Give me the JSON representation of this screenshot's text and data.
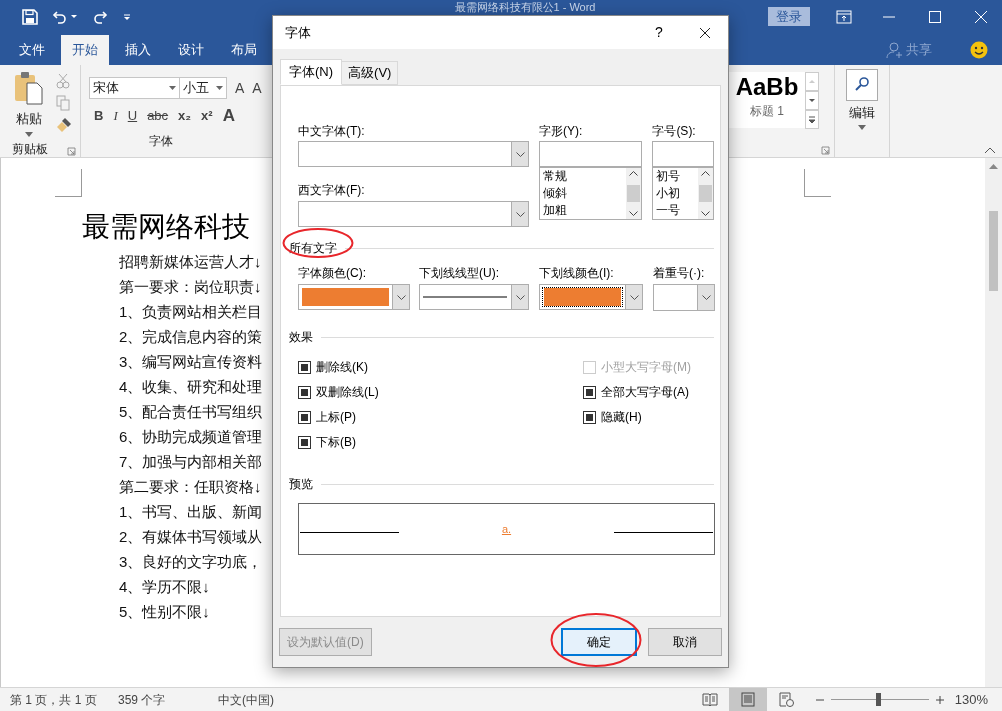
{
  "window": {
    "title": "最需网络科技有限公1 - Word",
    "signin": "登录",
    "share": "共享"
  },
  "tabs": [
    {
      "label": "文件",
      "selected": false
    },
    {
      "label": "开始",
      "selected": true
    },
    {
      "label": "插入",
      "selected": false
    },
    {
      "label": "设计",
      "selected": false
    },
    {
      "label": "布局",
      "selected": false
    }
  ],
  "ribbon": {
    "paste": "粘贴",
    "clipboard_label": "剪贴板",
    "font_name": "宋体",
    "font_size": "小五",
    "size_buttons": [
      "A",
      "A"
    ],
    "format_buttons": [
      "B",
      "I",
      "U",
      "abc",
      "x₂",
      "x²",
      "A"
    ],
    "font_label": "字体",
    "style_sample": "AaBb",
    "style_name": "标题 1",
    "editing_label": "编辑"
  },
  "document": {
    "title": "最需网络科技",
    "lines": [
      "招聘新媒体运营人才↓",
      "第一要求：岗位职责↓",
      "1、负责网站相关栏目",
      "2、完成信息内容的策",
      "3、编写网站宣传资料",
      "4、收集、研究和处理",
      "5、配合责任书写组织",
      "6、协助完成频道管理",
      "7、加强与内部相关部",
      "第二要求：任职资格↓",
      "1、书写、出版、新闻",
      "2、有媒体书写领域从",
      "3、良好的文字功底，",
      "4、学历不限↓",
      "5、性别不限↓"
    ]
  },
  "dialog": {
    "title": "字体",
    "help": "?",
    "tabs": [
      {
        "label": "字体(N)",
        "selected": true
      },
      {
        "label": "高级(V)",
        "selected": false
      }
    ],
    "chinese_font": {
      "label": "中文字体(T):"
    },
    "western_font": {
      "label": "西文字体(F):"
    },
    "font_style": {
      "label": "字形(Y):",
      "options": [
        {
          "label": "常规",
          "selected": false
        },
        {
          "label": "倾斜",
          "selected": false
        },
        {
          "label": "加粗",
          "selected": false
        }
      ]
    },
    "font_size": {
      "label": "字号(S):",
      "options": [
        {
          "label": "初号",
          "selected": false
        },
        {
          "label": "小初",
          "selected": false
        },
        {
          "label": "一号",
          "selected": false
        }
      ]
    },
    "all_text": {
      "title": "所有文字",
      "font_color": {
        "label": "字体颜色(C):",
        "color": "#ed7d31"
      },
      "underline_style": {
        "label": "下划线线型(U):",
        "kind": "single"
      },
      "underline_color": {
        "label": "下划线颜色(I):",
        "color": "#ed7d31",
        "focused": true
      },
      "emphasis": {
        "label": "着重号(·):"
      }
    },
    "effects": {
      "title": "效果",
      "left": [
        {
          "label": "删除线(K)",
          "checked": true,
          "disabled": false
        },
        {
          "label": "双删除线(L)",
          "checked": true,
          "disabled": false
        },
        {
          "label": "上标(P)",
          "checked": true,
          "disabled": false
        },
        {
          "label": "下标(B)",
          "checked": true,
          "disabled": false
        }
      ],
      "right": [
        {
          "label": "小型大写字母(M)",
          "checked": false,
          "disabled": true
        },
        {
          "label": "全部大写字母(A)",
          "checked": true,
          "disabled": false
        },
        {
          "label": "隐藏(H)",
          "checked": true,
          "disabled": false
        }
      ]
    },
    "preview": {
      "title": "预览",
      "text": "a."
    },
    "buttons": [
      {
        "label": "设为默认值(D)",
        "kind": "normal",
        "disabled": true
      },
      {
        "label": "确定",
        "kind": "default",
        "disabled": false
      },
      {
        "label": "取消",
        "kind": "normal",
        "disabled": false
      }
    ]
  },
  "status_bar": {
    "page": "第 1 页，共 1 页",
    "words": "359 个字",
    "language": "中文(中国)",
    "views": [
      {
        "kind": "read",
        "selected": false
      },
      {
        "kind": "print",
        "selected": true
      },
      {
        "kind": "web",
        "selected": false
      }
    ],
    "zoom": {
      "level": 0.48,
      "reading": "130%"
    }
  }
}
